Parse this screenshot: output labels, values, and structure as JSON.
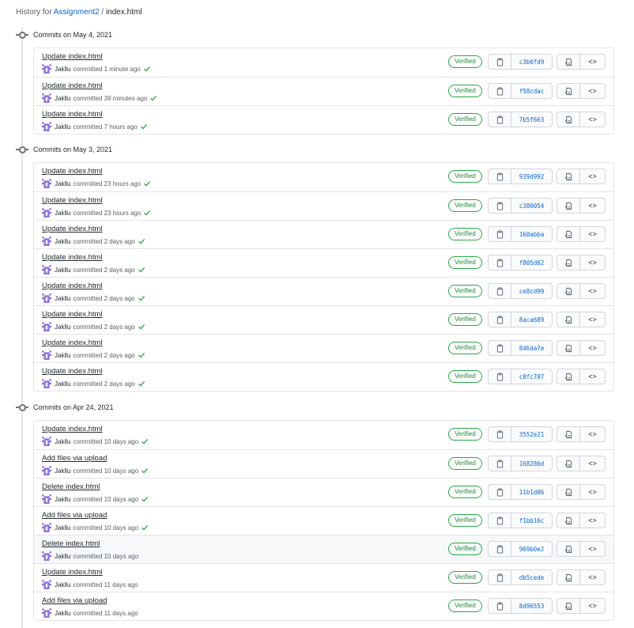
{
  "breadcrumb": {
    "prefix": "History for",
    "repo": "Assignment2",
    "separator": "/",
    "file": "index.html"
  },
  "groups": [
    {
      "heading": "Commits on May 4, 2021",
      "commits": [
        {
          "message": "Update index.html",
          "author": "Jakllu",
          "verb": "committed",
          "time": "1 minute ago",
          "check": true,
          "badge": "Verified",
          "sha": "c3b6fd9"
        },
        {
          "message": "Update index.html",
          "author": "Jakllu",
          "verb": "committed",
          "time": "39 minutes ago",
          "check": true,
          "badge": "Verified",
          "sha": "f58cdac"
        },
        {
          "message": "Update index.html",
          "author": "Jakllu",
          "verb": "committed",
          "time": "7 hours ago",
          "check": true,
          "badge": "Verified",
          "sha": "7b5f663"
        }
      ]
    },
    {
      "heading": "Commits on May 3, 2021",
      "commits": [
        {
          "message": "Update index.html",
          "author": "Jakllu",
          "verb": "committed",
          "time": "23 hours ago",
          "check": true,
          "badge": "Verified",
          "sha": "939d992"
        },
        {
          "message": "Update index.html",
          "author": "Jakllu",
          "verb": "committed",
          "time": "23 hours ago",
          "check": true,
          "badge": "Verified",
          "sha": "c380054"
        },
        {
          "message": "Update index.html",
          "author": "Jakllu",
          "verb": "committed",
          "time": "2 days ago",
          "check": true,
          "badge": "Verified",
          "sha": "168abba"
        },
        {
          "message": "Update index.html",
          "author": "Jakllu",
          "verb": "committed",
          "time": "2 days ago",
          "check": true,
          "badge": "Verified",
          "sha": "f805d62"
        },
        {
          "message": "Update index.html",
          "author": "Jakllu",
          "verb": "committed",
          "time": "2 days ago",
          "check": true,
          "badge": "Verified",
          "sha": "ce8cd99"
        },
        {
          "message": "Update index.html",
          "author": "Jakllu",
          "verb": "committed",
          "time": "2 days ago",
          "check": true,
          "badge": "Verified",
          "sha": "8aca689"
        },
        {
          "message": "Update index.html",
          "author": "Jakllu",
          "verb": "committed",
          "time": "2 days ago",
          "check": true,
          "badge": "Verified",
          "sha": "846da7e"
        },
        {
          "message": "Update index.html",
          "author": "Jakllu",
          "verb": "committed",
          "time": "2 days ago",
          "check": true,
          "badge": "Verified",
          "sha": "c8fc707"
        }
      ]
    },
    {
      "heading": "Commits on Apr 24, 2021",
      "commits": [
        {
          "message": "Update index.html",
          "author": "Jakllu",
          "verb": "committed",
          "time": "10 days ago",
          "check": true,
          "badge": "Verified",
          "sha": "3552e21"
        },
        {
          "message": "Add files via upload",
          "author": "Jakllu",
          "verb": "committed",
          "time": "10 days ago",
          "check": true,
          "badge": "Verified",
          "sha": "168286d"
        },
        {
          "message": "Delete index.html",
          "author": "Jakllu",
          "verb": "committed",
          "time": "10 days ago",
          "check": true,
          "badge": "Verified",
          "sha": "11b1d06"
        },
        {
          "message": "Add files via upload",
          "author": "Jakllu",
          "verb": "committed",
          "time": "10 days ago",
          "check": true,
          "badge": "Verified",
          "sha": "f1bb16c"
        },
        {
          "message": "Delete index.html",
          "author": "Jakllu",
          "verb": "committed",
          "time": "10 days ago",
          "check": false,
          "badge": "Verified",
          "sha": "969b0e2",
          "highlighted": true
        },
        {
          "message": "Update index.html",
          "author": "Jakllu",
          "verb": "committed",
          "time": "11 days ago",
          "check": false,
          "badge": "Verified",
          "sha": "db5cede"
        },
        {
          "message": "Add files via upload",
          "author": "Jakllu",
          "verb": "committed",
          "time": "11 days ago",
          "check": false,
          "badge": "Verified",
          "sha": "8d96553"
        }
      ]
    }
  ],
  "icons": {
    "timeline_node": "git-commit-icon",
    "avatar": "user-avatar-identicon",
    "check": "check-icon",
    "copy": "clipboard-icon",
    "browse": "file-browse-icon",
    "code": "code-icon"
  },
  "colors": {
    "link": "#0366d6",
    "check": "#28a745",
    "verified_text": "#22863a",
    "verified_border": "#28a745",
    "avatar": "#8c6fd6",
    "border": "#e1e4e8",
    "row_highlight": "#f6f8fa",
    "text_secondary": "#586069"
  },
  "code_glyph": "<>"
}
